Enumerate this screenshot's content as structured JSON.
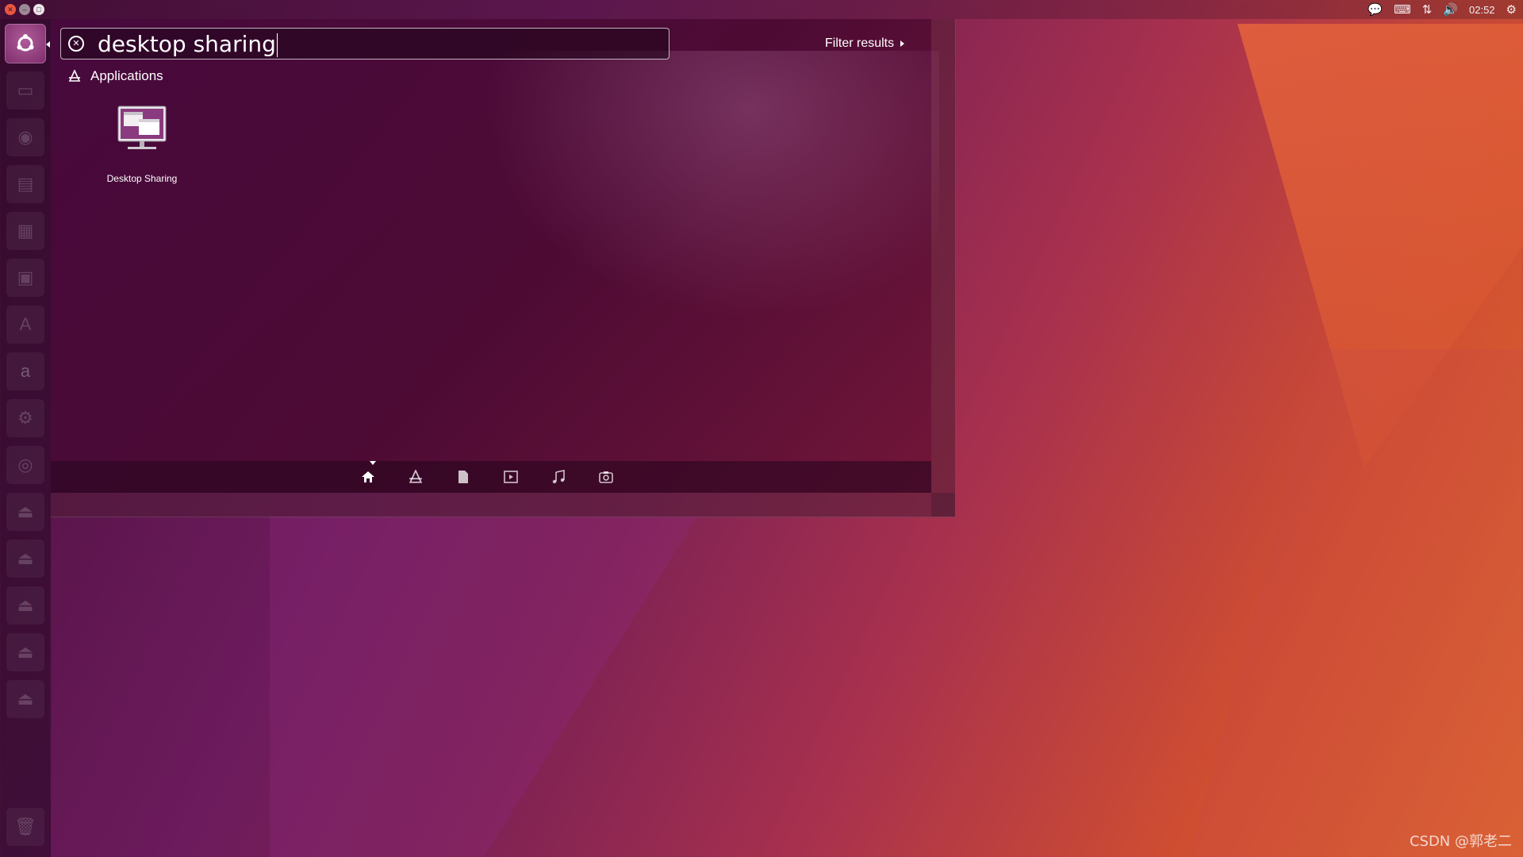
{
  "topbar": {
    "tray_icons": [
      "chat-icon",
      "keyboard-icon",
      "network-icon",
      "volume-icon"
    ],
    "clock": "02:52",
    "system_icon": "gear-icon"
  },
  "launcher": {
    "items": [
      "files-icon",
      "firefox-icon",
      "writer-icon",
      "calc-icon",
      "impress-icon",
      "software-center-icon",
      "amazon-icon",
      "settings-icon",
      "dvd-icon",
      "drive-icon",
      "drive-icon",
      "drive-icon",
      "drive-icon",
      "drive-icon",
      "trash-icon"
    ],
    "amazon_glyph": "a"
  },
  "dash": {
    "search_value": "desktop sharing",
    "filter_label": "Filter results",
    "category_label": "Applications",
    "results": [
      {
        "label": "Desktop Sharing",
        "icon": "desktop-sharing-icon"
      }
    ],
    "lenses": [
      "home-icon",
      "applications-icon",
      "files-icon",
      "video-icon",
      "music-icon",
      "photos-icon"
    ]
  },
  "watermark": "CSDN @郭老二"
}
